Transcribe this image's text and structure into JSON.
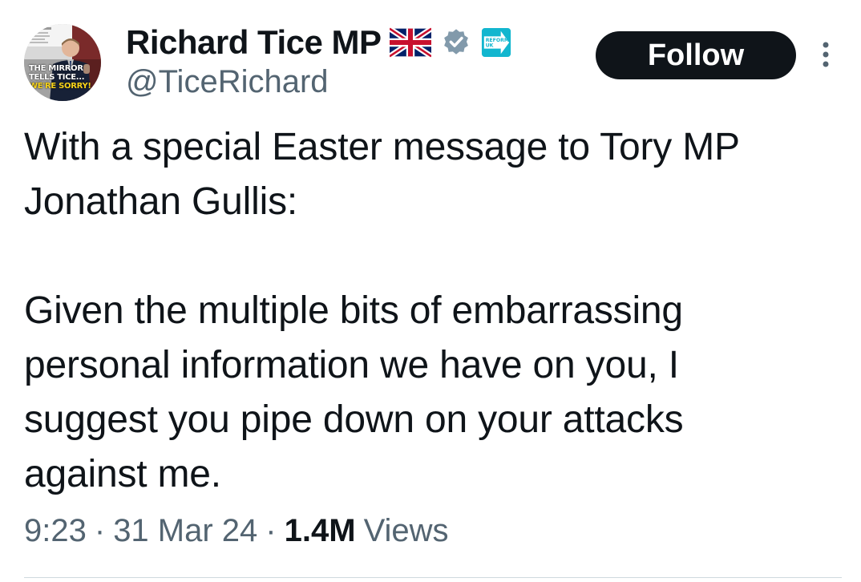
{
  "author": {
    "display_name": "Richard Tice MP",
    "handle": "@TiceRichard",
    "avatar_caption": {
      "line1": "THE MIRROR",
      "line2": "TELLS TICE...",
      "line3": "WE'RE SORRY!"
    },
    "badges": [
      "uk-flag-icon",
      "verified-badge-icon",
      "reform-uk-icon"
    ],
    "reform_badge_text": {
      "line1": "REFORM",
      "line2": "UK"
    }
  },
  "follow_button": {
    "label": "Follow"
  },
  "tweet": {
    "text": "With a special Easter message to Tory MP\nJonathan Gullis:\n\nGiven the multiple bits of embarrassing\npersonal information we have on you, I\nsuggest you pipe down on your attacks\nagainst me."
  },
  "meta": {
    "time": "9:23",
    "separator": "·",
    "date": "31 Mar 24",
    "views_count": "1.4M",
    "views_label": "Views"
  },
  "colors": {
    "text_primary": "#0f1419",
    "text_secondary": "#536471",
    "follow_bg": "#0f1419",
    "verified": "#829aab",
    "reform": "#12b6cf"
  }
}
